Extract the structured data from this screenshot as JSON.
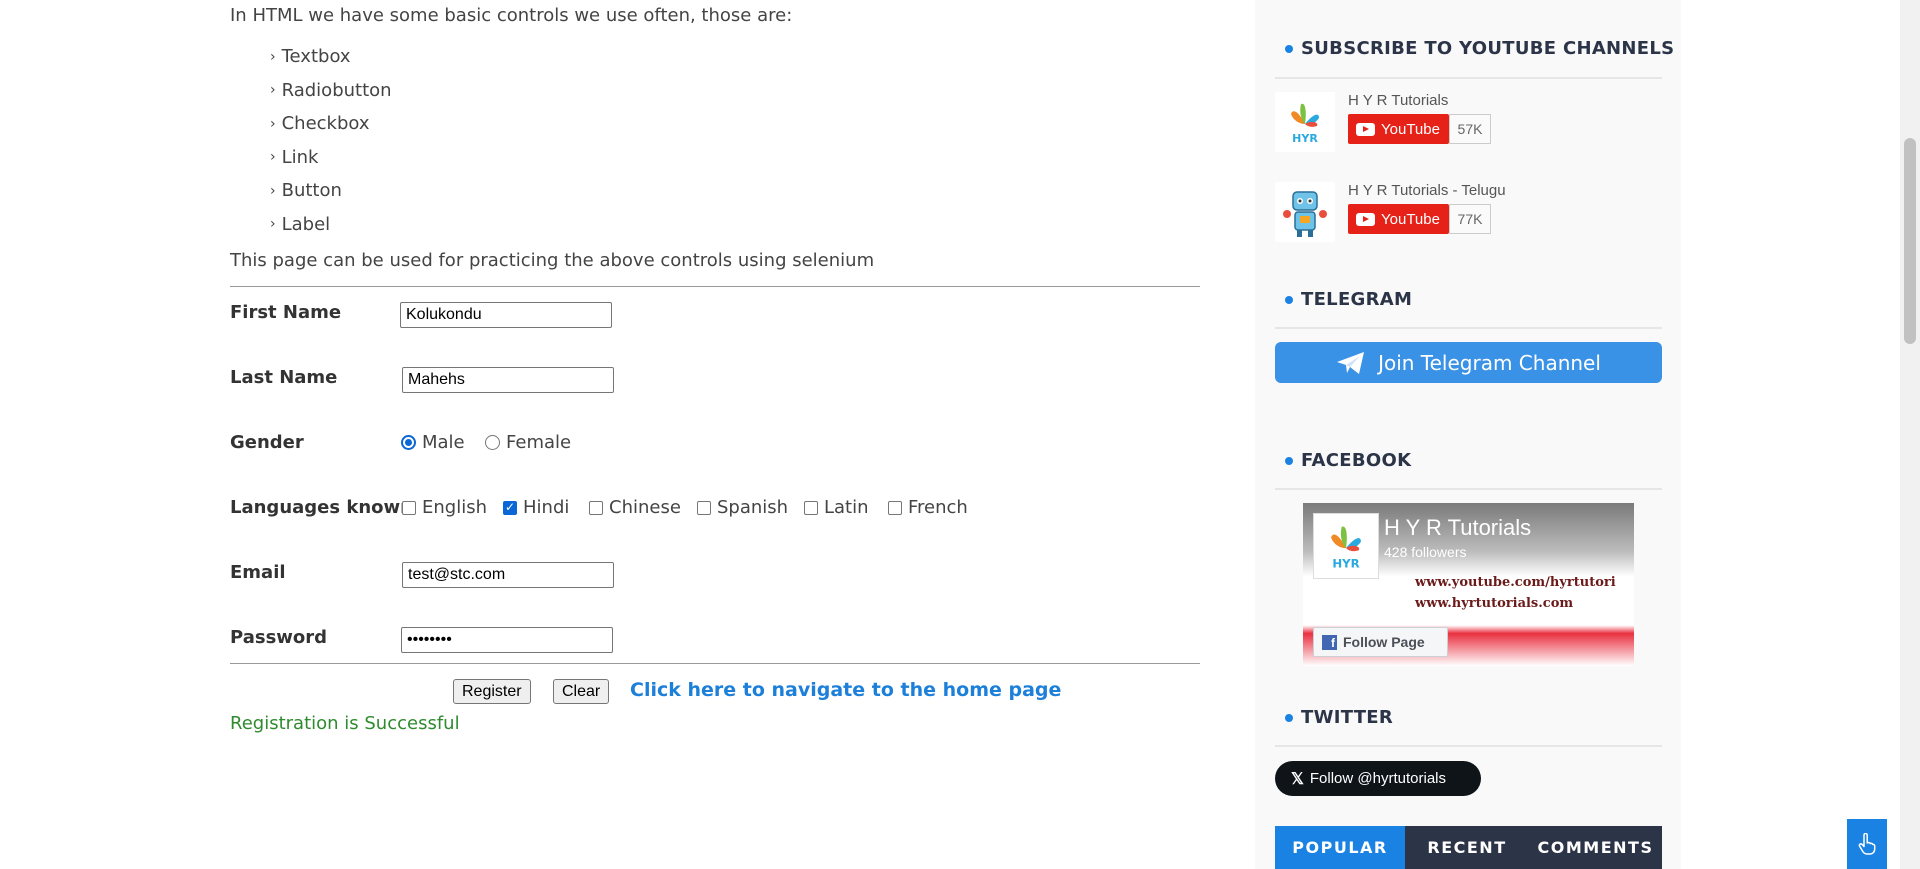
{
  "main": {
    "intro": "In HTML we have some basic controls we use often, those are:",
    "controls": [
      "Textbox",
      "Radiobutton",
      "Checkbox",
      "Link",
      "Button",
      "Label"
    ],
    "practice_text": "This page can be used for practicing the above controls using selenium",
    "form": {
      "first_name_label": "First Name",
      "first_name_value": "Kolukondu",
      "last_name_label": "Last Name",
      "last_name_value": "Mahehs",
      "gender_label": "Gender",
      "gender_options": [
        "Male",
        "Female"
      ],
      "gender_selected": "Male",
      "languages_label": "Languages known",
      "languages": [
        {
          "label": "English",
          "checked": false
        },
        {
          "label": "Hindi",
          "checked": true
        },
        {
          "label": "Chinese",
          "checked": false
        },
        {
          "label": "Spanish",
          "checked": false
        },
        {
          "label": "Latin",
          "checked": false
        },
        {
          "label": "French",
          "checked": false
        }
      ],
      "email_label": "Email",
      "email_value": "test@stc.com",
      "password_label": "Password",
      "password_value": "••••••••",
      "register_label": "Register",
      "clear_label": "Clear",
      "home_link": "Click here to navigate to the home page",
      "success_message": "Registration is Successful"
    }
  },
  "sidebar": {
    "youtube_title": "SUBSCRIBE TO YOUTUBE CHANNELS",
    "channels": [
      {
        "name": "H Y R Tutorials",
        "button": "YouTube",
        "count": "57K"
      },
      {
        "name": "H Y R Tutorials - Telugu",
        "button": "YouTube",
        "count": "77K"
      }
    ],
    "telegram_title": "TELEGRAM",
    "telegram_button": "Join Telegram Channel",
    "facebook_title": "FACEBOOK",
    "facebook": {
      "page_name": "H Y R Tutorials",
      "followers": "428 followers",
      "url1": "www.youtube.com/hyrtutori",
      "url2": "www.hyrtutorials.com",
      "follow_label": "Follow Page",
      "logo_text": "HYR"
    },
    "twitter_title": "TWITTER",
    "twitter_button": "Follow @hyrtutorials",
    "tabs": [
      "POPULAR",
      "RECENT",
      "COMMENTS"
    ],
    "active_tab": "POPULAR"
  },
  "colors": {
    "accent": "#1a82e2",
    "link": "#1c7fd9",
    "success": "#2e8b2e",
    "youtube": "#e62117",
    "telegram": "#3a92e6",
    "sidebar_bg": "#f9f9f9",
    "tab_dark": "#2c3448"
  }
}
